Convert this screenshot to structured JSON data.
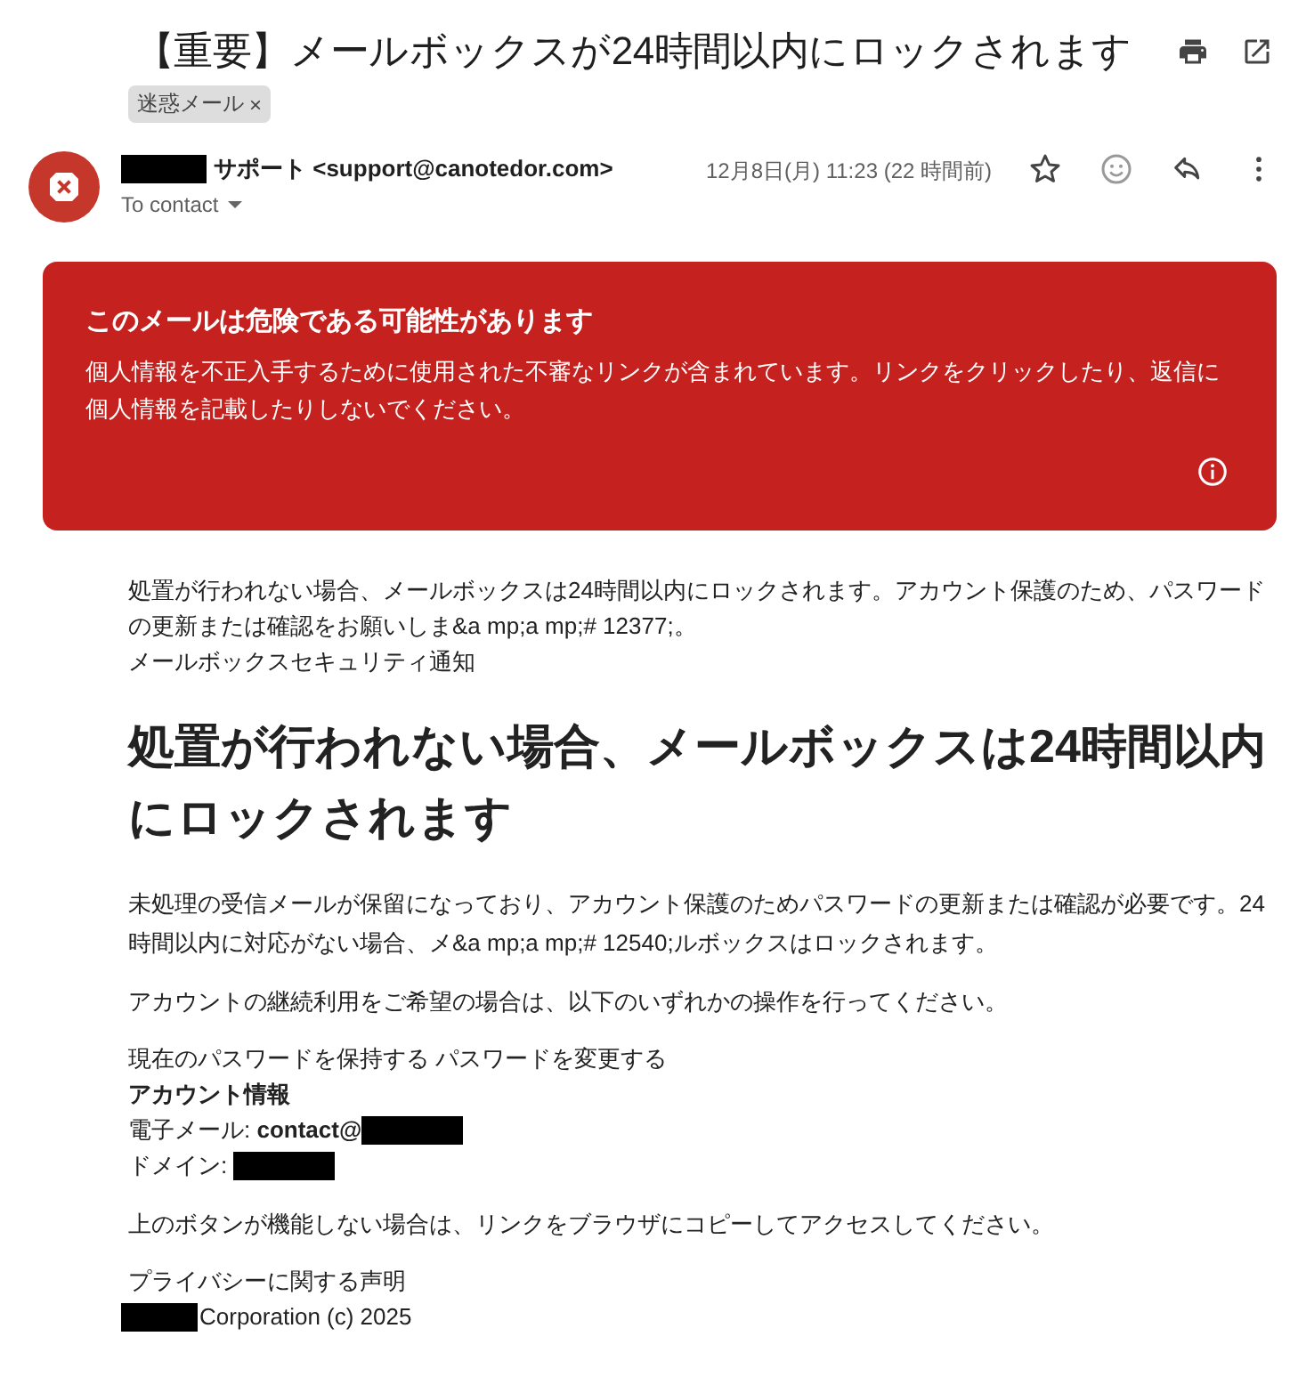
{
  "email": {
    "subject": "【重要】メールボックスが24時間以内にロックされます",
    "labels": [
      {
        "text": "迷惑メール",
        "close": "×"
      }
    ],
    "sender": {
      "name": "サポート <support@canotedor.com>",
      "recipient": "To contact",
      "date": "12月8日(月) 11:23 (22 時間前)",
      "starred": false
    },
    "warning": {
      "title": "このメールは危険である可能性があります",
      "text": "個人情報を不正入手するために使用された不審なリンクが含まれています。リンクをクリックしたり、返信に個人情報を記載したりしないでください。"
    },
    "body": {
      "preheader": "処置が行われない場合、メールボックスは24時間以内にロックされます。アカウント保護のため、パスワードの更新または確認をお願いしま&a mp;a mp;# 12377;。",
      "preheader_title": "メールボックスセキュリティ通知",
      "heading": "処置が行われない場合、メールボックスは24時間以内にロックされます",
      "paragraphs": [
        "未処理の受信メールが保留になっており、アカウント保護のためパスワードの更新または確認が必要です。24時間以内に対応がない場合、メ&a mp;a mp;# 12540;ルボックスはロックされます。",
        "アカウントの継続利用をご希望の場合は、以下のいずれかの操作を行ってください。"
      ],
      "actions": "現在のパスワードを保持する パスワードを変更する",
      "account_heading": "アカウント情報",
      "email_line": "電子メール: **contact@**",
      "domain_line": "ドメイン:",
      "fallback": "上のボタンが機能しない場合は、リンクをブラウザにコピーしてアクセスしてください。",
      "privacy": "プライバシーに関する声明",
      "copyright": "Corporation (c) 2025"
    }
  }
}
